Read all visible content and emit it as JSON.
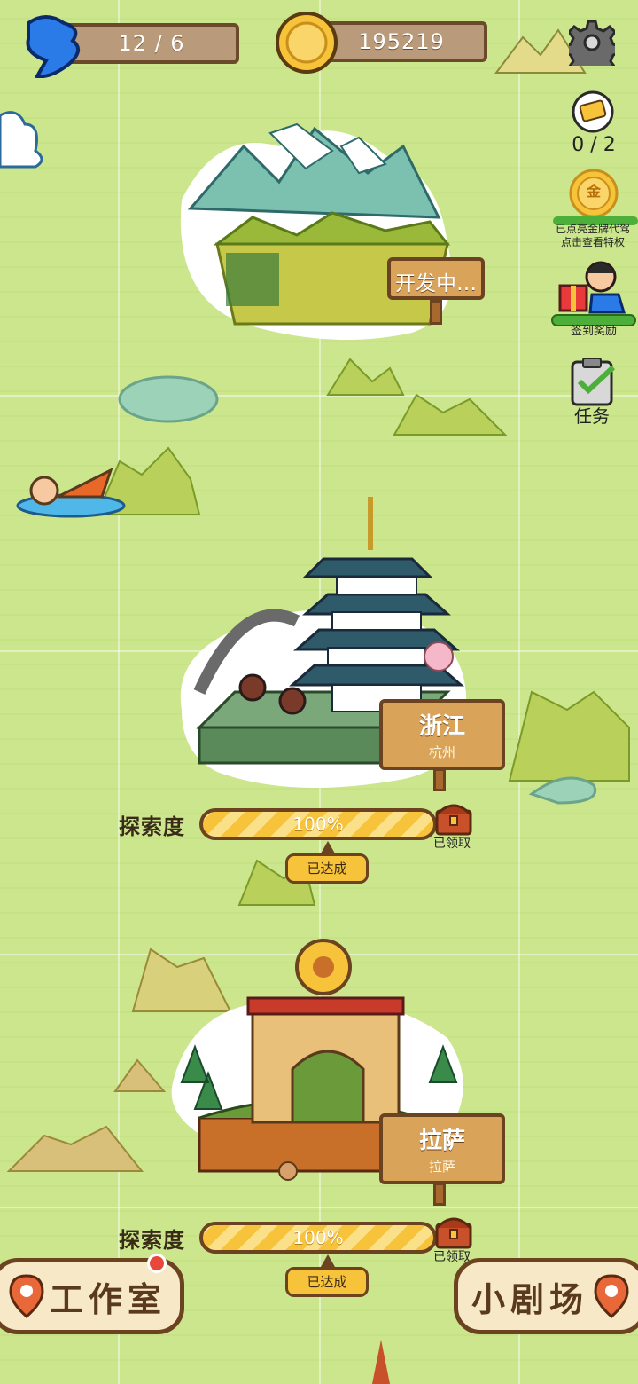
{
  "hud": {
    "energy": "12 / 6",
    "coins": "195219",
    "icons": [
      "energy-heart-icon",
      "gold-coin-icon",
      "settings-gear-icon"
    ]
  },
  "side_menu": {
    "ticket_count": "0 / 2",
    "gold_card_line1": "已点亮金牌代驾",
    "gold_card_line2": "点击查看特权",
    "gold_badge_char": "金",
    "checkin_label": "签到奖励",
    "task_label": "任务"
  },
  "locations": [
    {
      "name": "开发中…"
    },
    {
      "name": "浙江",
      "sub": "杭州",
      "progress_label": "探索度",
      "progress_text": "100%",
      "progress": 1.0,
      "status": "已达成",
      "chest_label": "已领取"
    },
    {
      "name": "拉萨",
      "sub": "拉萨",
      "progress_label": "探索度",
      "progress_text": "100%",
      "progress": 1.0,
      "status": "已达成",
      "chest_label": "已领取"
    }
  ],
  "bottom": {
    "left_button": "工作室",
    "right_button": "小剧场"
  },
  "colors": {
    "gold": "#f6c33a",
    "wood": "#d9a45a",
    "outline": "#6b4320",
    "grass": "#cbe68c",
    "heart": "#2a7be8"
  }
}
